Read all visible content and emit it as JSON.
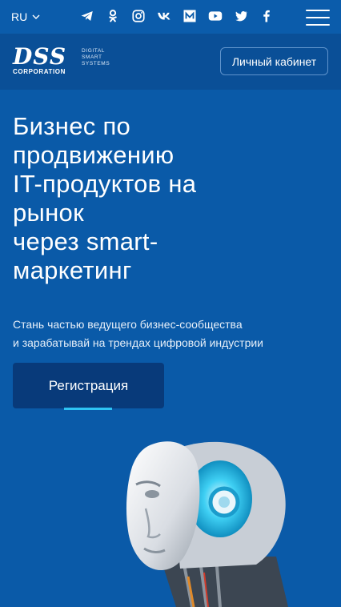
{
  "topbar": {
    "language": "RU",
    "socials": [
      {
        "name": "telegram"
      },
      {
        "name": "odnoklassniki"
      },
      {
        "name": "instagram"
      },
      {
        "name": "vk"
      },
      {
        "name": "medium"
      },
      {
        "name": "youtube"
      },
      {
        "name": "twitter"
      },
      {
        "name": "facebook"
      }
    ]
  },
  "header": {
    "logo_main": "DSS",
    "logo_sub": "CORPORATION",
    "logo_tag_1": "DIGITAL",
    "logo_tag_2": "SMART",
    "logo_tag_3": "SYSTEMS",
    "cabinet_label": "Личный кабинет"
  },
  "hero": {
    "title_lines": [
      "Бизнес по",
      "продвижению",
      "IT-продуктов на",
      "рынок",
      "через smart-",
      "маркетинг"
    ],
    "subtitle_line_1": "Стань частью ведущего бизнес-сообщества",
    "subtitle_line_2": "и зарабатывай на трендах цифровой индустрии",
    "register_label": "Регистрация"
  },
  "colors": {
    "background": "#0a5aa8",
    "header": "#0a4f97",
    "button": "#083a7a",
    "accent": "#2ec3f3"
  }
}
